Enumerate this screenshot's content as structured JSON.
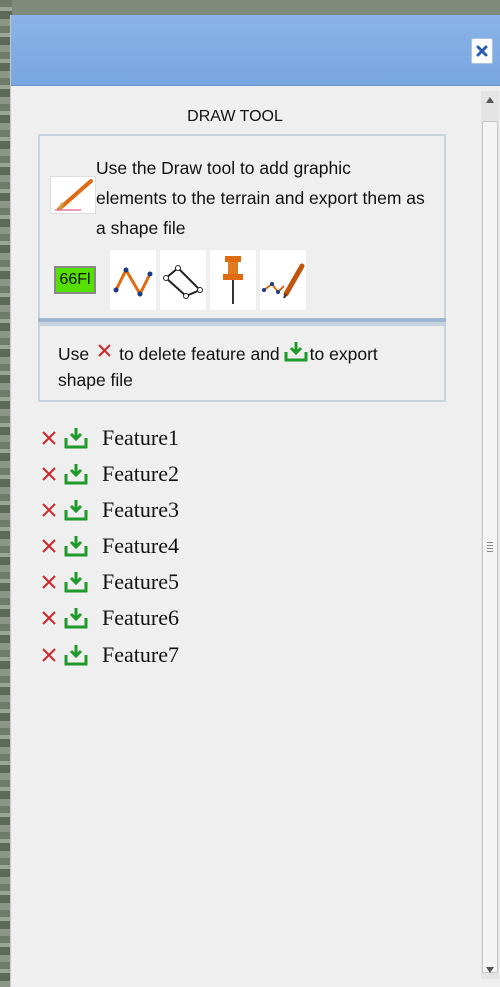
{
  "window": {
    "close_icon": "close-icon",
    "title": ""
  },
  "draw_tool": {
    "title": "DRAW TOOL",
    "intro_text": "Use the Draw tool to add graphic elements to the terrain and export them as a shape file",
    "intro_icon": "pencil-icon",
    "tools": [
      {
        "label": "66Fl",
        "icon": "label-text-icon",
        "color": "#55e000"
      },
      {
        "icon": "polyline-icon"
      },
      {
        "icon": "polygon-icon"
      },
      {
        "icon": "pushpin-icon"
      },
      {
        "icon": "freehand-pencil-icon"
      }
    ]
  },
  "instructions": {
    "use": "Use",
    "delete_part": "to delete feature and",
    "export_part": "to export",
    "line2": "shape file"
  },
  "features": [
    {
      "name": "Feature1"
    },
    {
      "name": "Feature2"
    },
    {
      "name": "Feature3"
    },
    {
      "name": "Feature4"
    },
    {
      "name": "Feature5"
    },
    {
      "name": "Feature6"
    },
    {
      "name": "Feature7"
    }
  ],
  "colors": {
    "titlebar": "#78a6e0",
    "delete_red": "#cc2a2a",
    "export_green": "#1f9a2a",
    "tool_orange": "#e06a10"
  }
}
